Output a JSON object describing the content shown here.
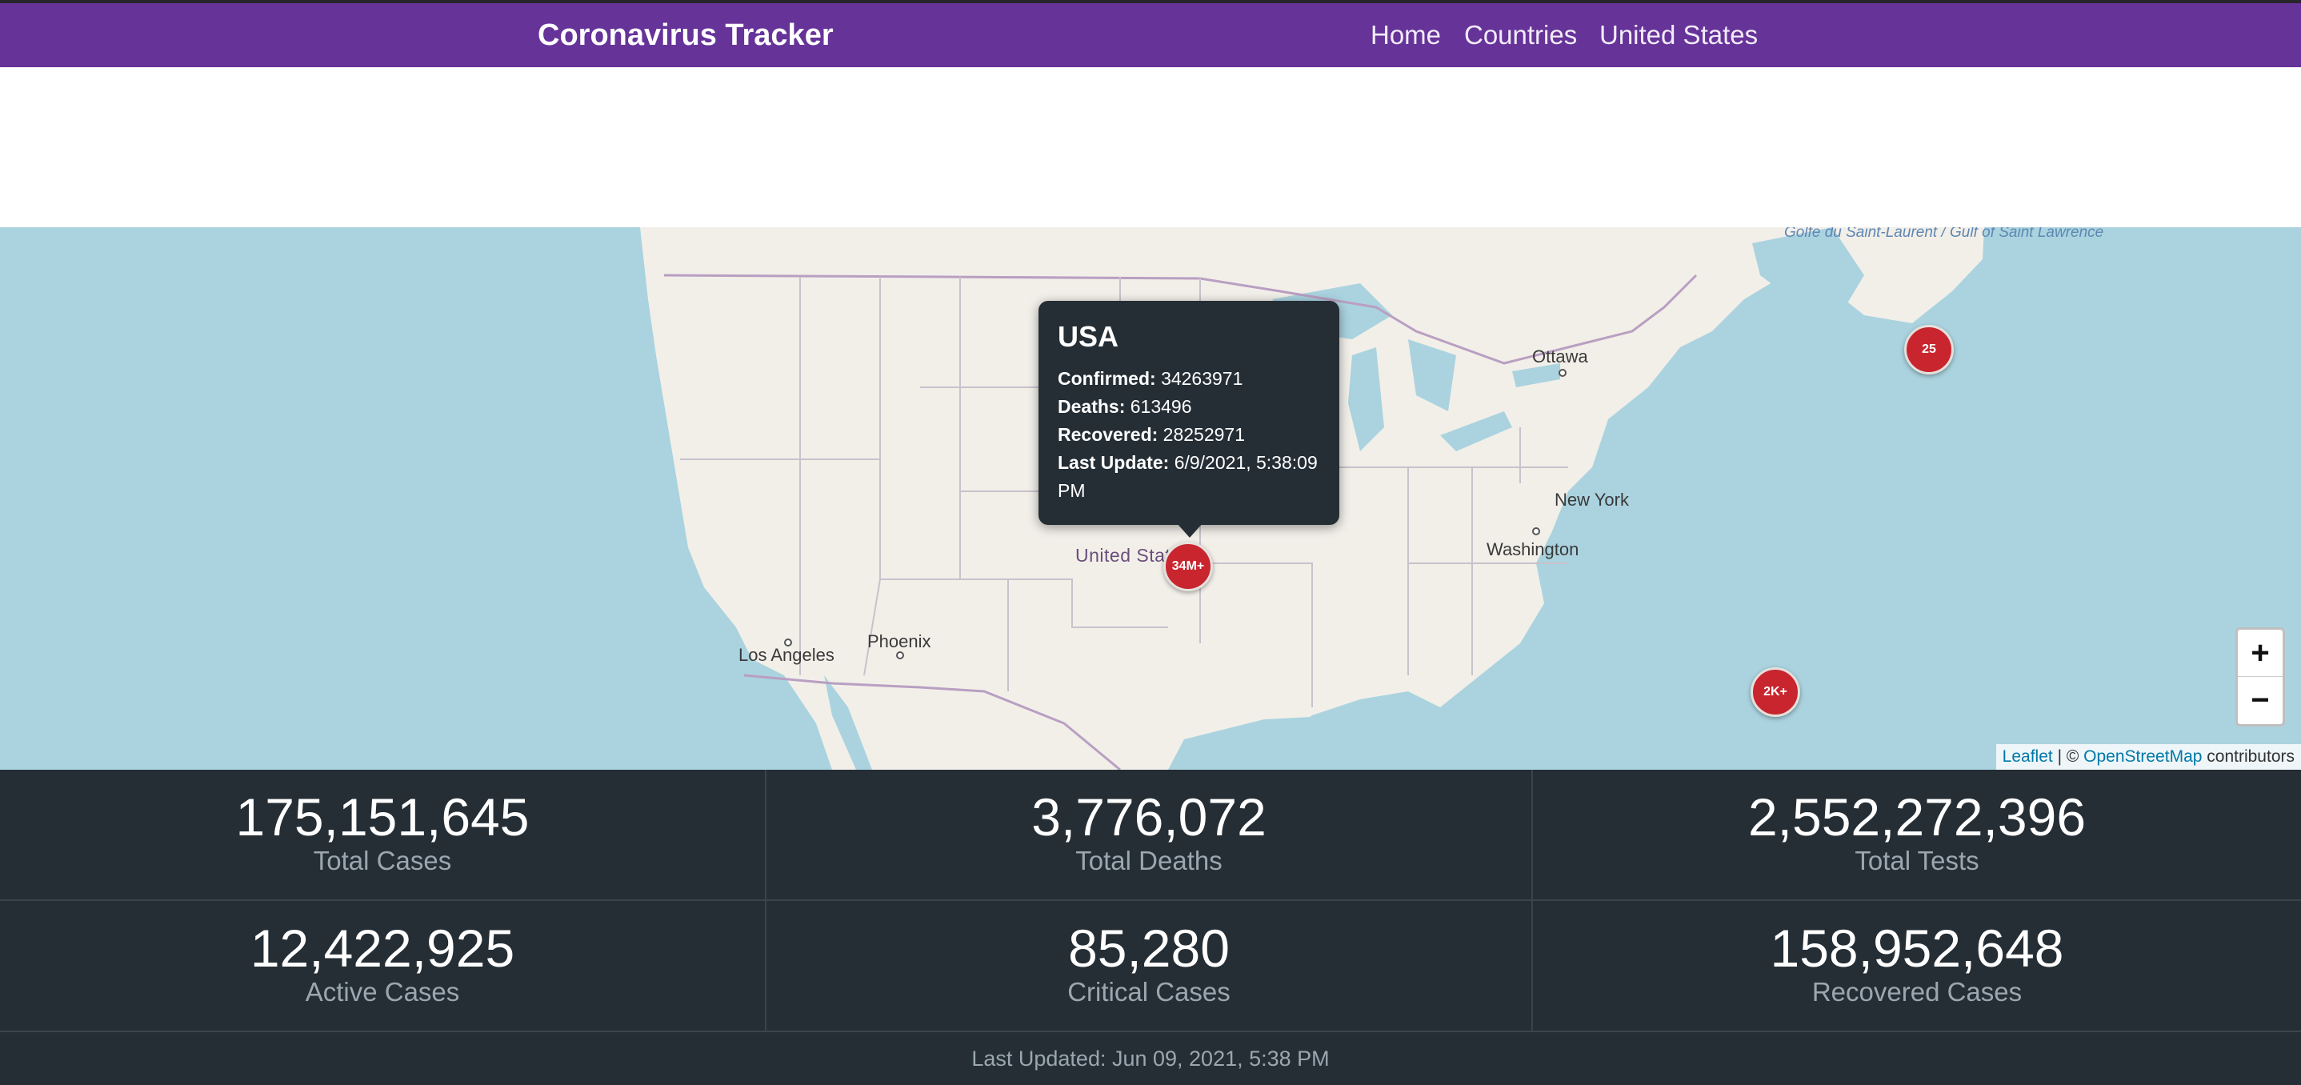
{
  "navbar": {
    "brand": "Coronavirus Tracker",
    "links": [
      "Home",
      "Countries",
      "United States"
    ],
    "background": "#663399"
  },
  "map": {
    "labels": {
      "ottawa": "Ottawa",
      "new_york": "New York",
      "washington": "Washington",
      "los_angeles": "Los Angeles",
      "phoenix": "Phoenix",
      "united_states": "United States",
      "gulf": "Golfe du Saint-Laurent / Gulf of Saint Lawrence"
    },
    "clusters": {
      "usa": "34M+",
      "northeast": "25",
      "atlantic": "2K+"
    },
    "popup": {
      "title": "USA",
      "confirmed_label": "Confirmed:",
      "confirmed": "34263971",
      "deaths_label": "Deaths:",
      "deaths": "613496",
      "recovered_label": "Recovered:",
      "recovered": "28252971",
      "last_update_label": "Last Update:",
      "last_update": "6/9/2021, 5:38:09 PM"
    },
    "zoom": {
      "in": "+",
      "out": "−"
    },
    "attribution": {
      "leaflet": "Leaflet",
      "separator": " | © ",
      "osm": "OpenStreetMap",
      "suffix": " contributors"
    },
    "colors": {
      "water": "#aad3df",
      "land": "#f2efe9",
      "cluster": "#c9252f"
    }
  },
  "stats": {
    "total_cases": {
      "value": "175,151,645",
      "label": "Total Cases"
    },
    "total_deaths": {
      "value": "3,776,072",
      "label": "Total Deaths"
    },
    "total_tests": {
      "value": "2,552,272,396",
      "label": "Total Tests"
    },
    "active_cases": {
      "value": "12,422,925",
      "label": "Active Cases"
    },
    "critical_cases": {
      "value": "85,280",
      "label": "Critical Cases"
    },
    "recovered_cases": {
      "value": "158,952,648",
      "label": "Recovered Cases"
    },
    "last_updated": "Last Updated: Jun 09, 2021, 5:38 PM"
  }
}
